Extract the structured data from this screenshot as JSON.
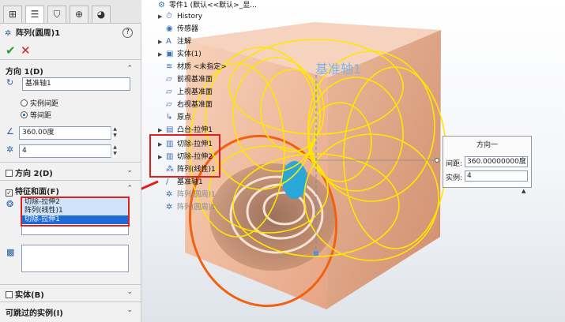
{
  "property_manager": {
    "tab_icons": [
      "feature-manager-icon",
      "property-manager-icon",
      "configuration-icon",
      "dimxpert-icon",
      "display-manager-icon"
    ],
    "title": "阵列(圆周)1",
    "ok_symbol": "✔",
    "cancel_symbol": "✕",
    "help_symbol": "?",
    "direction1": {
      "title": "方向 1(D)",
      "axis_value": "基准轴1",
      "option_instance_spacing": "实例间距",
      "option_equal_spacing": "等间距",
      "angle_value": "360.00度",
      "count_value": "4"
    },
    "direction2": {
      "title": "方向 2(D)"
    },
    "features_faces": {
      "title": "特征和面(F)",
      "items": [
        "切除-拉伸2",
        "阵列(线性)1",
        "切除-拉伸1"
      ]
    },
    "bodies": {
      "title": "实体(B)"
    },
    "skip_instances": {
      "title": "可跳过的实例(I)"
    }
  },
  "tree": {
    "root": "零件1  (默认<<默认>_显...",
    "items": [
      {
        "label": "History",
        "icon": "history-icon"
      },
      {
        "label": "传感器",
        "icon": "sensor-icon"
      },
      {
        "label": "注解",
        "icon": "annotation-icon"
      },
      {
        "label": "实体(1)",
        "icon": "solid-bodies-icon"
      },
      {
        "label": "材质 <未指定>",
        "icon": "material-icon"
      },
      {
        "label": "前视基准面",
        "icon": "plane-icon"
      },
      {
        "label": "上视基准面",
        "icon": "plane-icon"
      },
      {
        "label": "右视基准面",
        "icon": "plane-icon"
      },
      {
        "label": "原点",
        "icon": "origin-icon"
      },
      {
        "label": "凸台-拉伸1",
        "icon": "boss-extrude-icon"
      },
      {
        "label": "切除-拉伸1",
        "icon": "cut-extrude-icon"
      },
      {
        "label": "切除-拉伸2",
        "icon": "cut-extrude-icon"
      },
      {
        "label": "阵列(线性)1",
        "icon": "linear-pattern-icon"
      },
      {
        "label": "基准轴1",
        "icon": "axis-icon"
      },
      {
        "label": "阵列(圆周)1",
        "icon": "circular-pattern-icon"
      },
      {
        "label": "阵列(圆周)1",
        "icon": "circular-pattern-icon"
      }
    ]
  },
  "viewport": {
    "axis_label": "基准轴1"
  },
  "callout": {
    "title": "方向一",
    "spacing_label": "间距:",
    "spacing_value": "360.00000000度",
    "instances_label": "实例:",
    "instances_value": "4"
  },
  "colors": {
    "highlight_red": "#e0201b",
    "pattern_yellow": "#ffe600",
    "cube_face": "#f0bfa2",
    "selection_blue": "#1e6ad6"
  }
}
